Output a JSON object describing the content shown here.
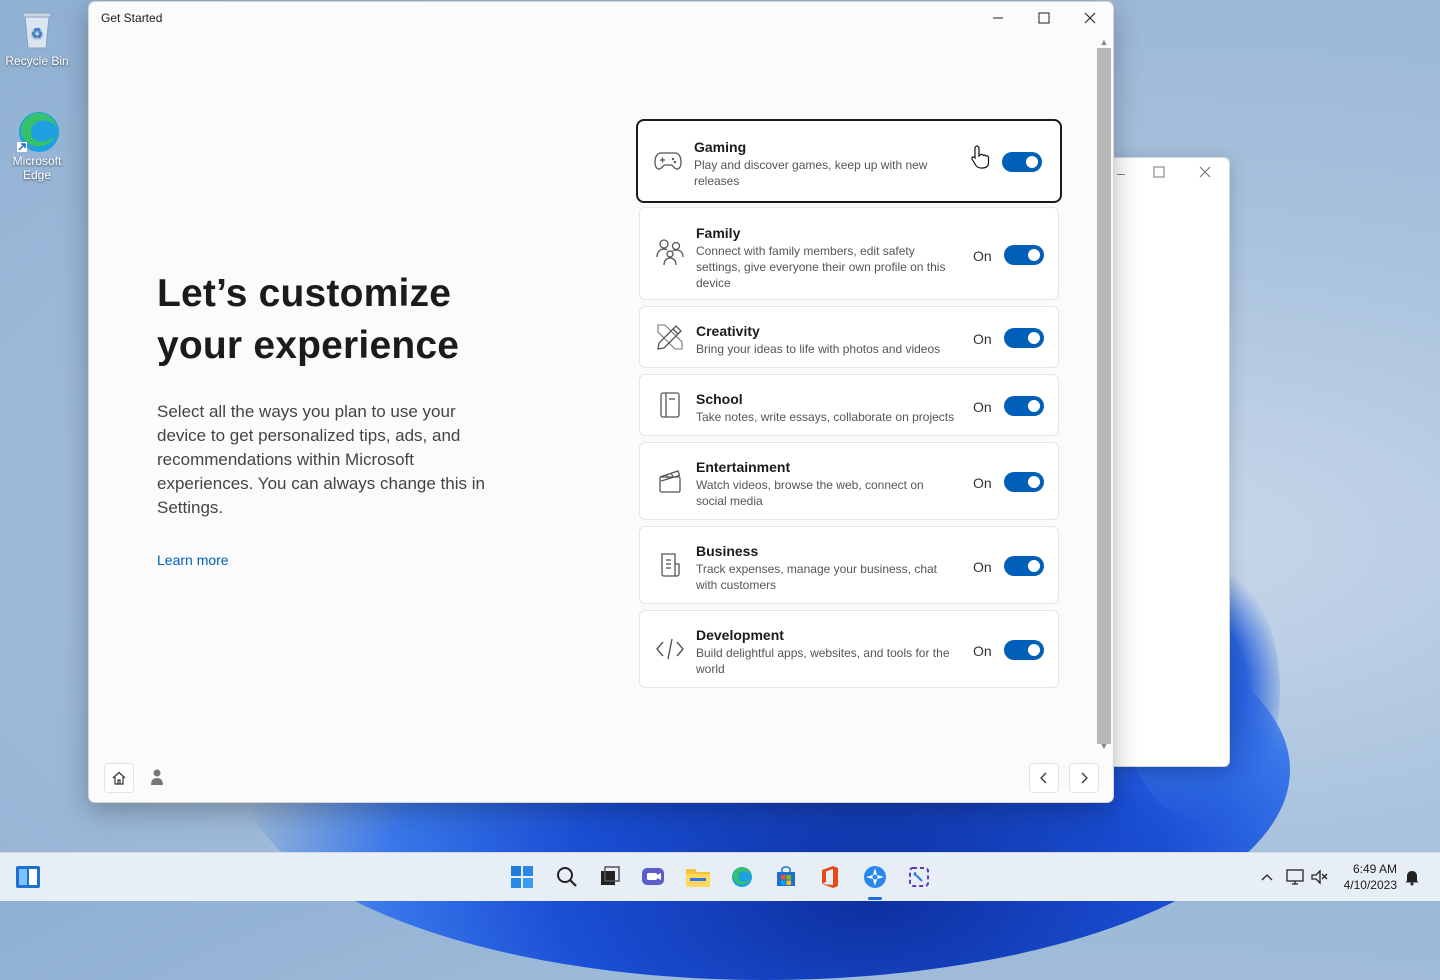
{
  "desktop": {
    "icons": [
      {
        "label": "Recycle Bin",
        "icon": "recycle-bin-icon"
      },
      {
        "label": "Microsoft Edge",
        "icon": "edge-icon"
      }
    ]
  },
  "window": {
    "title": "Get Started",
    "heading_line1": "Let’s customize",
    "heading_line2": "your experience",
    "description": "Select all the ways you plan to use your device to get personalized tips, ads, and recommendations within Microsoft experiences. You can always change this in Settings.",
    "learn_more": "Learn more"
  },
  "cards": [
    {
      "name": "Gaming",
      "desc": "Play and discover games, keep up with new releases",
      "state": "",
      "icon": "gamepad-icon",
      "on": true
    },
    {
      "name": "Family",
      "desc": "Connect with family members, edit safety settings, give everyone their own profile on this device",
      "state": "On",
      "icon": "family-icon",
      "on": true
    },
    {
      "name": "Creativity",
      "desc": "Bring your ideas to life with photos and videos",
      "state": "On",
      "icon": "pencil-ruler-icon",
      "on": true
    },
    {
      "name": "School",
      "desc": "Take notes, write essays, collaborate on projects",
      "state": "On",
      "icon": "notebook-icon",
      "on": true
    },
    {
      "name": "Entertainment",
      "desc": "Watch videos, browse the web, connect on social media",
      "state": "On",
      "icon": "clapperboard-icon",
      "on": true
    },
    {
      "name": "Business",
      "desc": "Track expenses, manage your business, chat with customers",
      "state": "On",
      "icon": "document-icon",
      "on": true
    },
    {
      "name": "Development",
      "desc": "Build delightful apps, websites, and tools for the world",
      "state": "On",
      "icon": "code-icon",
      "on": true
    }
  ],
  "taskbar": {
    "time": "6:49 AM",
    "date": "4/10/2023"
  },
  "colors": {
    "accent": "#005fb8"
  }
}
